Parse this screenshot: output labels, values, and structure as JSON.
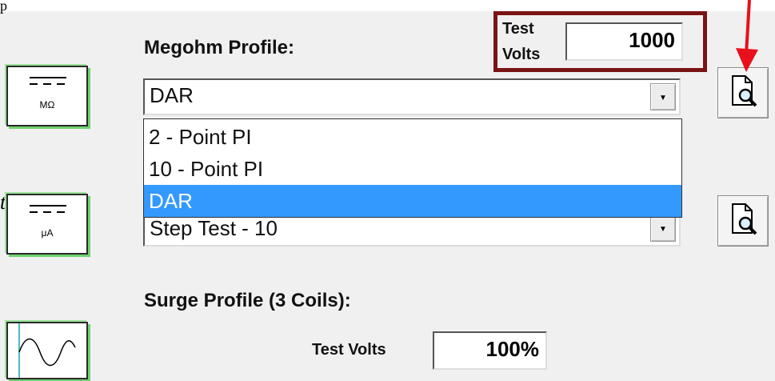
{
  "top_text": "p",
  "left_partial_text": "t",
  "meter_buttons": [
    {
      "unit": "MΩ"
    },
    {
      "unit": "μA"
    },
    {
      "unit": ""
    }
  ],
  "megohm": {
    "title": "Megohm Profile:",
    "selected": "DAR",
    "dropdown_arrow": "▼",
    "options": [
      "2 - Point PI",
      "10 - Point PI",
      "DAR"
    ],
    "highlighted_option": "DAR"
  },
  "second_profile": {
    "selected": "Step Test - 10",
    "dropdown_arrow": "▼"
  },
  "test_volts_top": {
    "label_line1": "Test",
    "label_line2": "Volts",
    "value": "1000"
  },
  "surge": {
    "title": "Surge Profile (3 Coils):",
    "test_volts_label": "Test Volts",
    "test_volts_value": "100%"
  },
  "colors": {
    "highlight_box": "#7a1414",
    "annotation_arrow": "#e8101a",
    "selected_option": "#3399ff",
    "meter_glow": "#6fd26f"
  },
  "icons": [
    "magnifier-document-icon",
    "dc-symbol-icon",
    "sine-wave-icon",
    "red-arrow-annotation"
  ]
}
